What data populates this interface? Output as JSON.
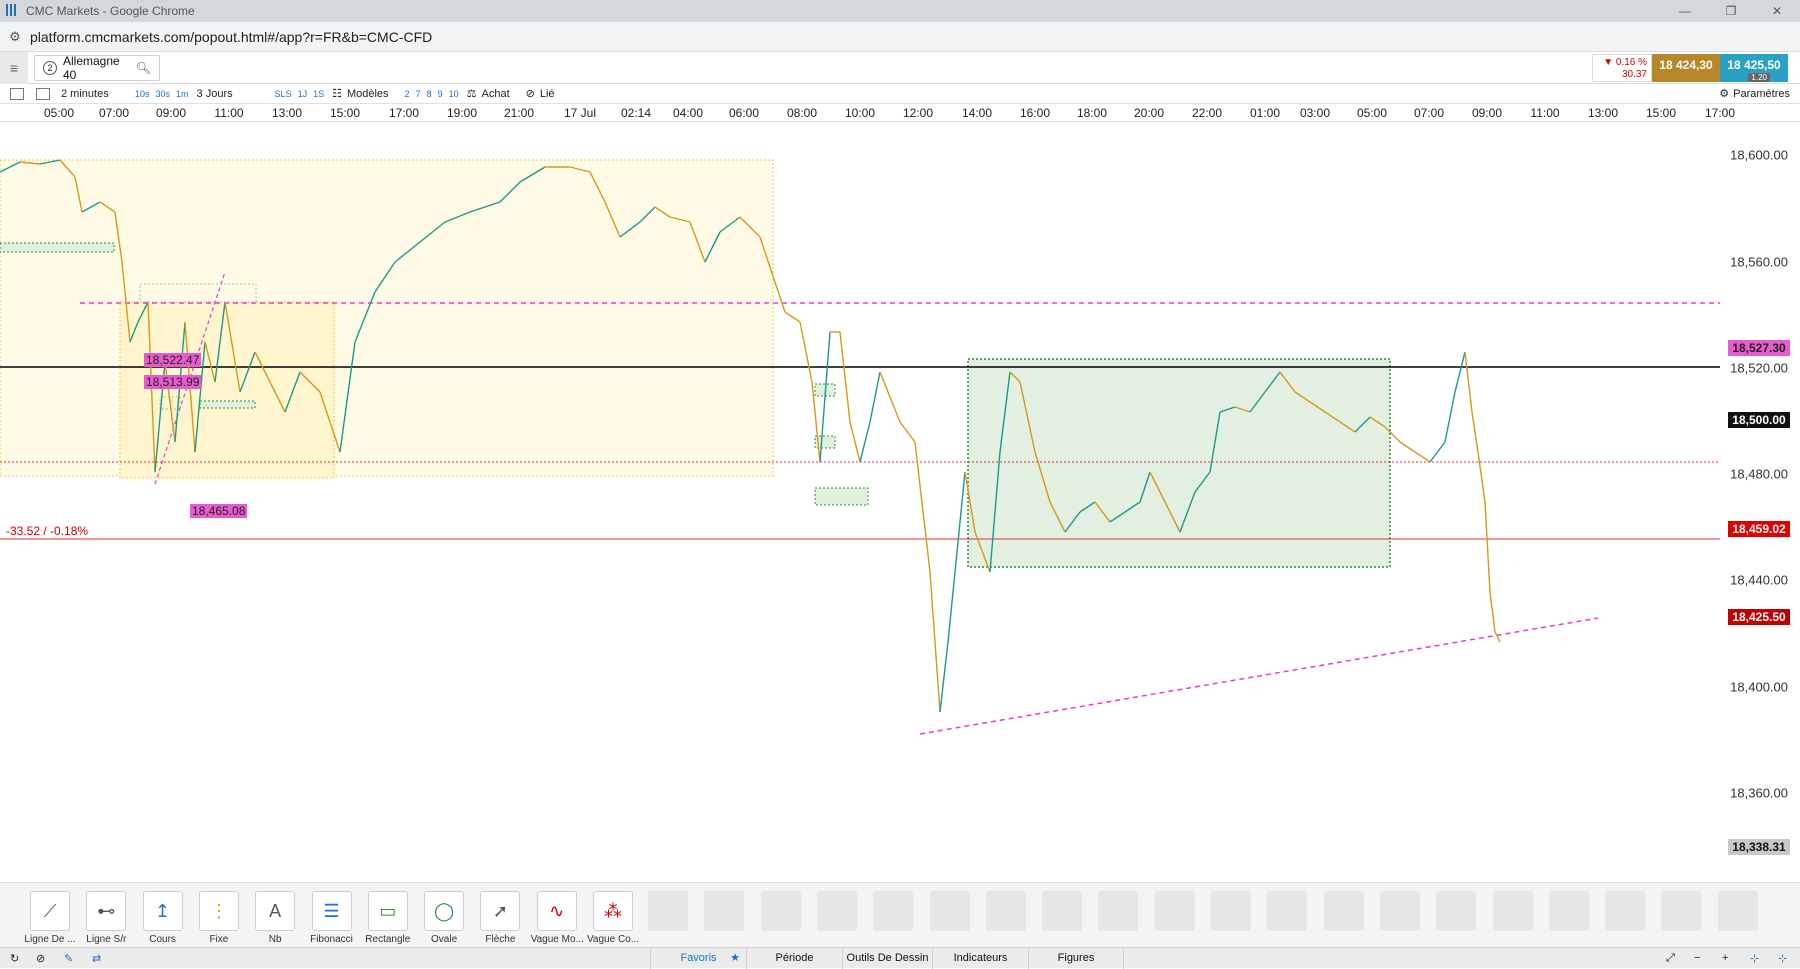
{
  "window": {
    "title": "CMC Markets - Google Chrome",
    "controls": [
      "—",
      "❐",
      "✕"
    ]
  },
  "address": {
    "url": "platform.cmcmarkets.com/popout.html#/app?r=FR&b=CMC-CFD"
  },
  "header": {
    "instrument_num": "2",
    "instrument_name": "Allemagne 40",
    "change_pct": "▼ 0.16 %",
    "change_pts": "30.37",
    "sell": "18 424,30",
    "buy": "18 425,50",
    "spread": "1.20"
  },
  "toolbar": {
    "interval": "2 minutes",
    "t10s": "10s",
    "t30s": "30s",
    "t1m": "1m",
    "range": "3 Jours",
    "sls": "SLS",
    "d1j": "1J",
    "d1s": "1S",
    "models": "Modèles",
    "n2": "2",
    "n7": "7",
    "n8": "8",
    "n9": "9",
    "n10": "10",
    "buy": "Achat",
    "linked": "Lié",
    "settings": "Paramètres"
  },
  "time_axis": [
    "05:00",
    "07:00",
    "09:00",
    "11:00",
    "13:00",
    "15:00",
    "17:00",
    "19:00",
    "21:00",
    "17 Jul",
    "02:14",
    "04:00",
    "06:00",
    "08:00",
    "10:00",
    "12:00",
    "14:00",
    "16:00",
    "18:00",
    "20:00",
    "22:00",
    "01:00",
    "03:00",
    "05:00",
    "07:00",
    "09:00",
    "11:00",
    "13:00",
    "15:00",
    "17:00"
  ],
  "price_axis": [
    "18,600.00",
    "18,560.00",
    "18,520.00",
    "18,480.00",
    "18,440.00",
    "18,400.00",
    "18,360.00"
  ],
  "price_tags": {
    "level1": "18,527.30",
    "level2": "18,500.00",
    "level3": "18,459.02",
    "current": "18,425.50",
    "low": "18,338.31"
  },
  "chart_labels": {
    "a": "18,522.47",
    "b": "18,513.99",
    "c": "18,465.08",
    "change": "-33.52 / -0.18%"
  },
  "tools": [
    "Ligne De ...",
    "Ligne S/r",
    "Cours",
    "Fixe",
    "Nb",
    "Fibonacci",
    "Rectangle",
    "Ovale",
    "Flèche",
    "Vague Mo...",
    "Vague Co..."
  ],
  "tabs": {
    "favoris": "Favoris",
    "periode": "Période",
    "outils": "Outils De Dessin",
    "indicateurs": "Indicateurs",
    "figures": "Figures"
  },
  "colors": {
    "up": "#1a9a8a",
    "down": "#d49a1a",
    "pink": "#e040d0",
    "red": "#d00000",
    "green_box": "#2e8b3a",
    "yellow_box": "#fff3c4"
  }
}
